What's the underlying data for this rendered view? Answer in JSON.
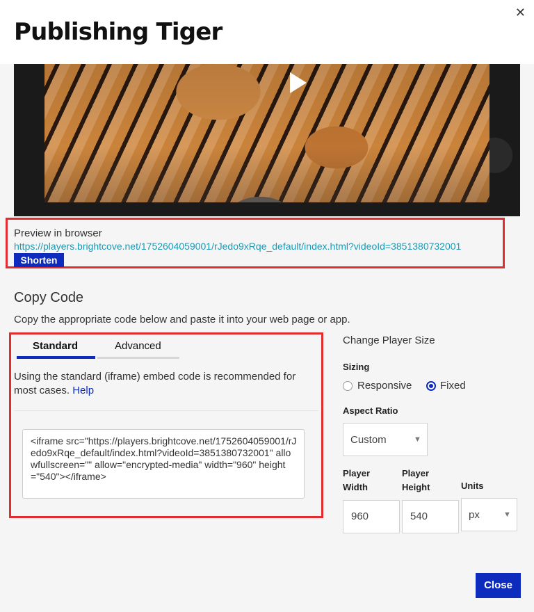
{
  "header": {
    "title": "Publishing Tiger",
    "close_glyph": "✕"
  },
  "video": {
    "play_icon": "play-icon"
  },
  "preview": {
    "label": "Preview in browser",
    "url": "https://players.brightcove.net/1752604059001/rJedo9xRqe_default/index.html?videoId=3851380732001",
    "shorten_label": "Shorten"
  },
  "copy_code": {
    "title": "Copy Code",
    "description": "Copy the appropriate code below and paste it into your web page or app.",
    "tabs": [
      {
        "label": "Standard",
        "active": true
      },
      {
        "label": "Advanced",
        "active": false
      }
    ],
    "note": "Using the standard (iframe) embed code is recommended for most cases.",
    "help_label": "Help",
    "code": "<iframe src=\"https://players.brightcove.net/1752604059001/rJedo9xRqe_default/index.html?videoId=3851380732001\" allowfullscreen=\"\" allow=\"encrypted-media\" width=\"960\" height=\"540\"></iframe>"
  },
  "player_size": {
    "title": "Change Player Size",
    "sizing_label": "Sizing",
    "sizing_options": [
      {
        "label": "Responsive",
        "checked": false
      },
      {
        "label": "Fixed",
        "checked": true
      }
    ],
    "aspect_ratio_label": "Aspect Ratio",
    "aspect_ratio_value": "Custom",
    "width_label_1": "Player",
    "width_label_2": "Width",
    "width_value": "960",
    "height_label_1": "Player",
    "height_label_2": "Height",
    "height_value": "540",
    "units_label": "Units",
    "units_value": "px",
    "caret_glyph": "▼"
  },
  "footer": {
    "close_label": "Close"
  },
  "colors": {
    "accent": "#0d2bbd",
    "link": "#1a9bb5",
    "highlight": "#e32c32"
  }
}
